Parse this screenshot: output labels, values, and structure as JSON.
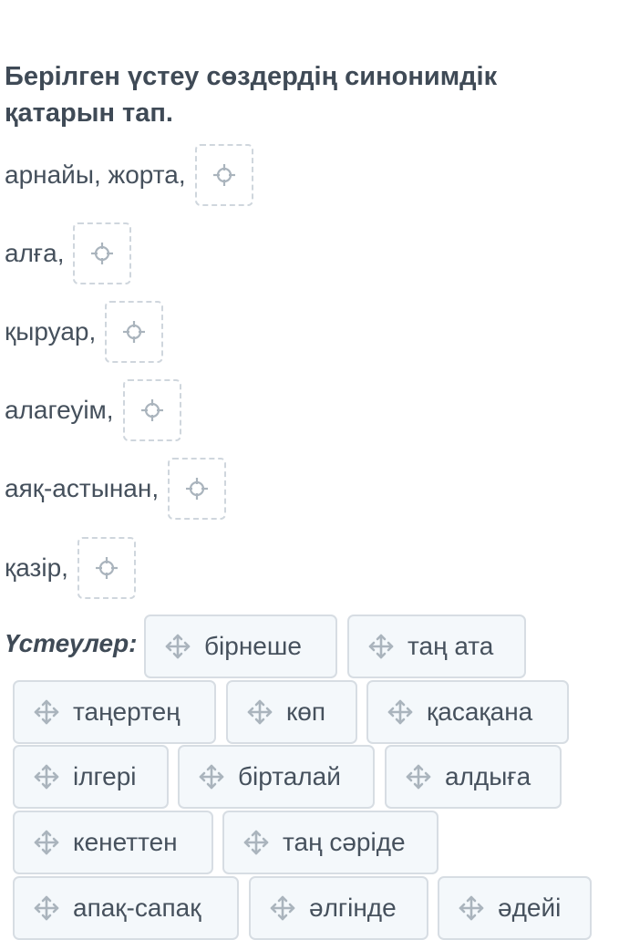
{
  "question": {
    "title": "Берілген үстеу сөздердің синонимдік қатарын тап."
  },
  "rows": [
    {
      "label": "арнайы, жорта,"
    },
    {
      "label": "алға,"
    },
    {
      "label": "қыруар,"
    },
    {
      "label": "алагеуім,"
    },
    {
      "label": "аяқ-астынан,"
    },
    {
      "label": "қазір,"
    }
  ],
  "bank": {
    "label": "Үстеулер:",
    "items": [
      "бірнеше",
      "таң ата",
      "таңертең",
      "көп",
      "қасақана",
      "ілгері",
      "бірталай",
      "алдыға",
      "кенеттен",
      "таң сәріде",
      "апақ-сапақ",
      "әлгінде",
      "әдейі"
    ]
  },
  "colors": {
    "text": "#3f4a56",
    "chip_bg": "#f4f8fb",
    "chip_border": "#d7dde3",
    "drop_border": "#cfd6dd",
    "icon": "#aab4bd"
  },
  "icons": {
    "drop_target": "crosshair-target-icon",
    "drag_handle": "move-arrows-icon"
  }
}
